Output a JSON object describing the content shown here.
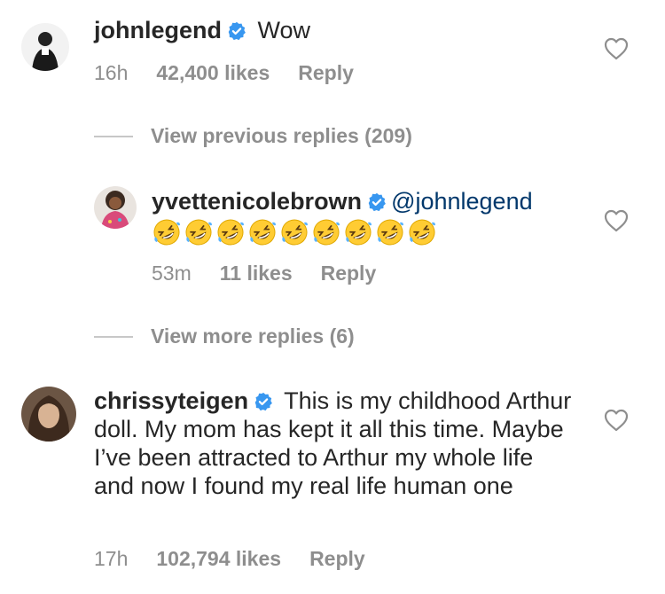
{
  "comments": [
    {
      "username": "johnlegend",
      "text": "Wow",
      "time": "16h",
      "likes": "42,400 likes",
      "reply": "Reply"
    },
    {
      "username": "yvettenicolebrown",
      "mention": "@johnlegend",
      "emoji_count": 9,
      "emoji_name": "rolling-on-floor-laughing",
      "time": "53m",
      "likes": "11 likes",
      "reply": "Reply"
    },
    {
      "username": "chrissyteigen",
      "text": "This is my childhood Arthur doll. My mom has kept it all this time. Maybe I’ve been attracted to Arthur my whole life and now I found my real life human one",
      "time": "17h",
      "likes": "102,794 likes",
      "reply": "Reply"
    }
  ],
  "view_previous": "View previous replies (209)",
  "view_more": "View more replies (6)",
  "colors": {
    "verified": "#3897f0",
    "meta": "#8e8e8e",
    "mention": "#00376b"
  }
}
